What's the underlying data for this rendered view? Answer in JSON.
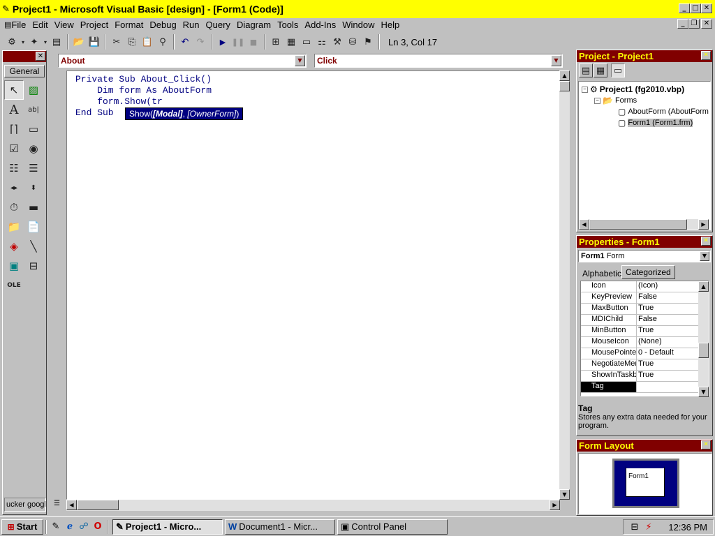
{
  "window": {
    "title": "Project1 - Microsoft Visual Basic [design] - [Form1 (Code)]"
  },
  "menu": [
    "File",
    "Edit",
    "View",
    "Project",
    "Format",
    "Debug",
    "Run",
    "Query",
    "Diagram",
    "Tools",
    "Add-Ins",
    "Window",
    "Help"
  ],
  "toolbar": {
    "position": "Ln 3, Col 17"
  },
  "toolbox": {
    "tab": "General",
    "bottom_label": "ucker google"
  },
  "code": {
    "object_combo": "About",
    "proc_combo": "Click",
    "lines": [
      "Private Sub About_Click()",
      "    Dim form As AboutForm",
      "    form.Show(tr",
      "End Sub"
    ],
    "intellisense": {
      "prefix": "Show(",
      "param1": "[Modal]",
      "sep": ", ",
      "param2": "[OwnerForm]",
      "suffix": ")"
    }
  },
  "project": {
    "title": "Project - Project1",
    "root": "Project1 (fg2010.vbp)",
    "folder": "Forms",
    "items": [
      "AboutForm (AboutForm",
      "Form1 (Form1.frm)"
    ]
  },
  "properties": {
    "title": "Properties - Form1",
    "object_name": "Form1",
    "object_type": "Form",
    "tabs": [
      "Alphabetic",
      "Categorized"
    ],
    "rows": [
      {
        "name": "Icon",
        "value": "(Icon)"
      },
      {
        "name": "KeyPreview",
        "value": "False"
      },
      {
        "name": "MaxButton",
        "value": "True"
      },
      {
        "name": "MDIChild",
        "value": "False"
      },
      {
        "name": "MinButton",
        "value": "True"
      },
      {
        "name": "MouseIcon",
        "value": "(None)"
      },
      {
        "name": "MousePointer",
        "value": "0 - Default"
      },
      {
        "name": "NegotiateMenus",
        "value": "True"
      },
      {
        "name": "ShowInTaskbar",
        "value": "True"
      },
      {
        "name": "Tag",
        "value": ""
      }
    ],
    "desc_title": "Tag",
    "desc_text": "Stores any extra data needed for your program."
  },
  "layout": {
    "title": "Form Layout",
    "form_label": "Form1"
  },
  "taskbar": {
    "start": "Start",
    "tasks": [
      "Project1 - Micro...",
      "Document1 - Micr...",
      "Control Panel"
    ],
    "clock": "12:36 PM"
  }
}
